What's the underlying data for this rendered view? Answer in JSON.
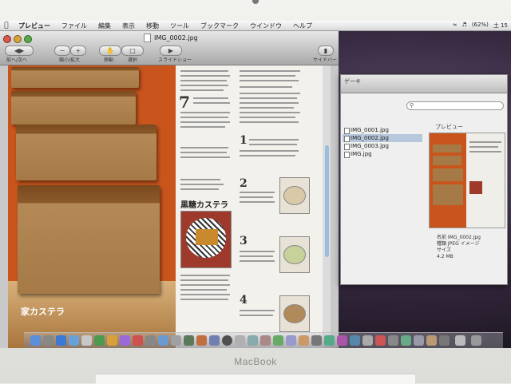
{
  "menubar": {
    "app_name": "プレビュー",
    "items": [
      "ファイル",
      "編集",
      "表示",
      "移動",
      "ツール",
      "ブックマーク",
      "ウインドウ",
      "ヘルプ"
    ],
    "status_right": [
      "(62%)",
      "土 15"
    ]
  },
  "preview_window": {
    "title": "IMG_0002.jpg",
    "toolbar": {
      "prev_next_label": "前へ/次へ",
      "zoom_label": "縮小/拡大",
      "move_label": "移動",
      "select_label": "選択",
      "slideshow_label": "スライドショー",
      "sidebar_label": "サイドバー",
      "zoom_minus": "−",
      "zoom_plus": "+"
    },
    "page": {
      "cake_caption": "家カステラ",
      "section_title": "黒糖カステラ",
      "step_numbers": [
        "7",
        "1",
        "2",
        "3",
        "4"
      ]
    }
  },
  "finder_window": {
    "title": "ゲーキ",
    "preview_label": "プレビュー",
    "files": [
      {
        "name": "IMG_0001.jpg",
        "selected": false
      },
      {
        "name": "IMG_0002.jpg",
        "selected": true
      },
      {
        "name": "IMG_0003.jpg",
        "selected": false
      },
      {
        "name": "IMG.jpg",
        "selected": false
      }
    ],
    "meta": [
      "名前 IMG_0002.jpg",
      "種類 JPEG イメージ",
      "サイズ",
      "4.2 MB"
    ]
  },
  "device": {
    "brand": "MacBook"
  },
  "colors": {
    "photo_background": "#c9551c",
    "selection": "#b8c8dc",
    "close_button": "#d9574a"
  }
}
